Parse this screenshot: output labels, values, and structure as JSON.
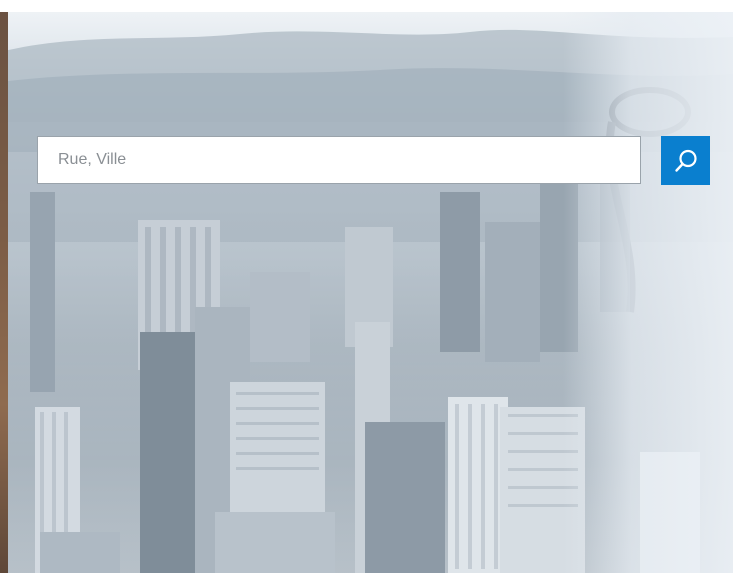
{
  "search": {
    "placeholder": "Rue, Ville",
    "value": "",
    "button_icon": "search-icon"
  },
  "colors": {
    "accent": "#0a7fcf",
    "input_border": "#9aa3ab",
    "background_tint": "#b9c5cf"
  }
}
